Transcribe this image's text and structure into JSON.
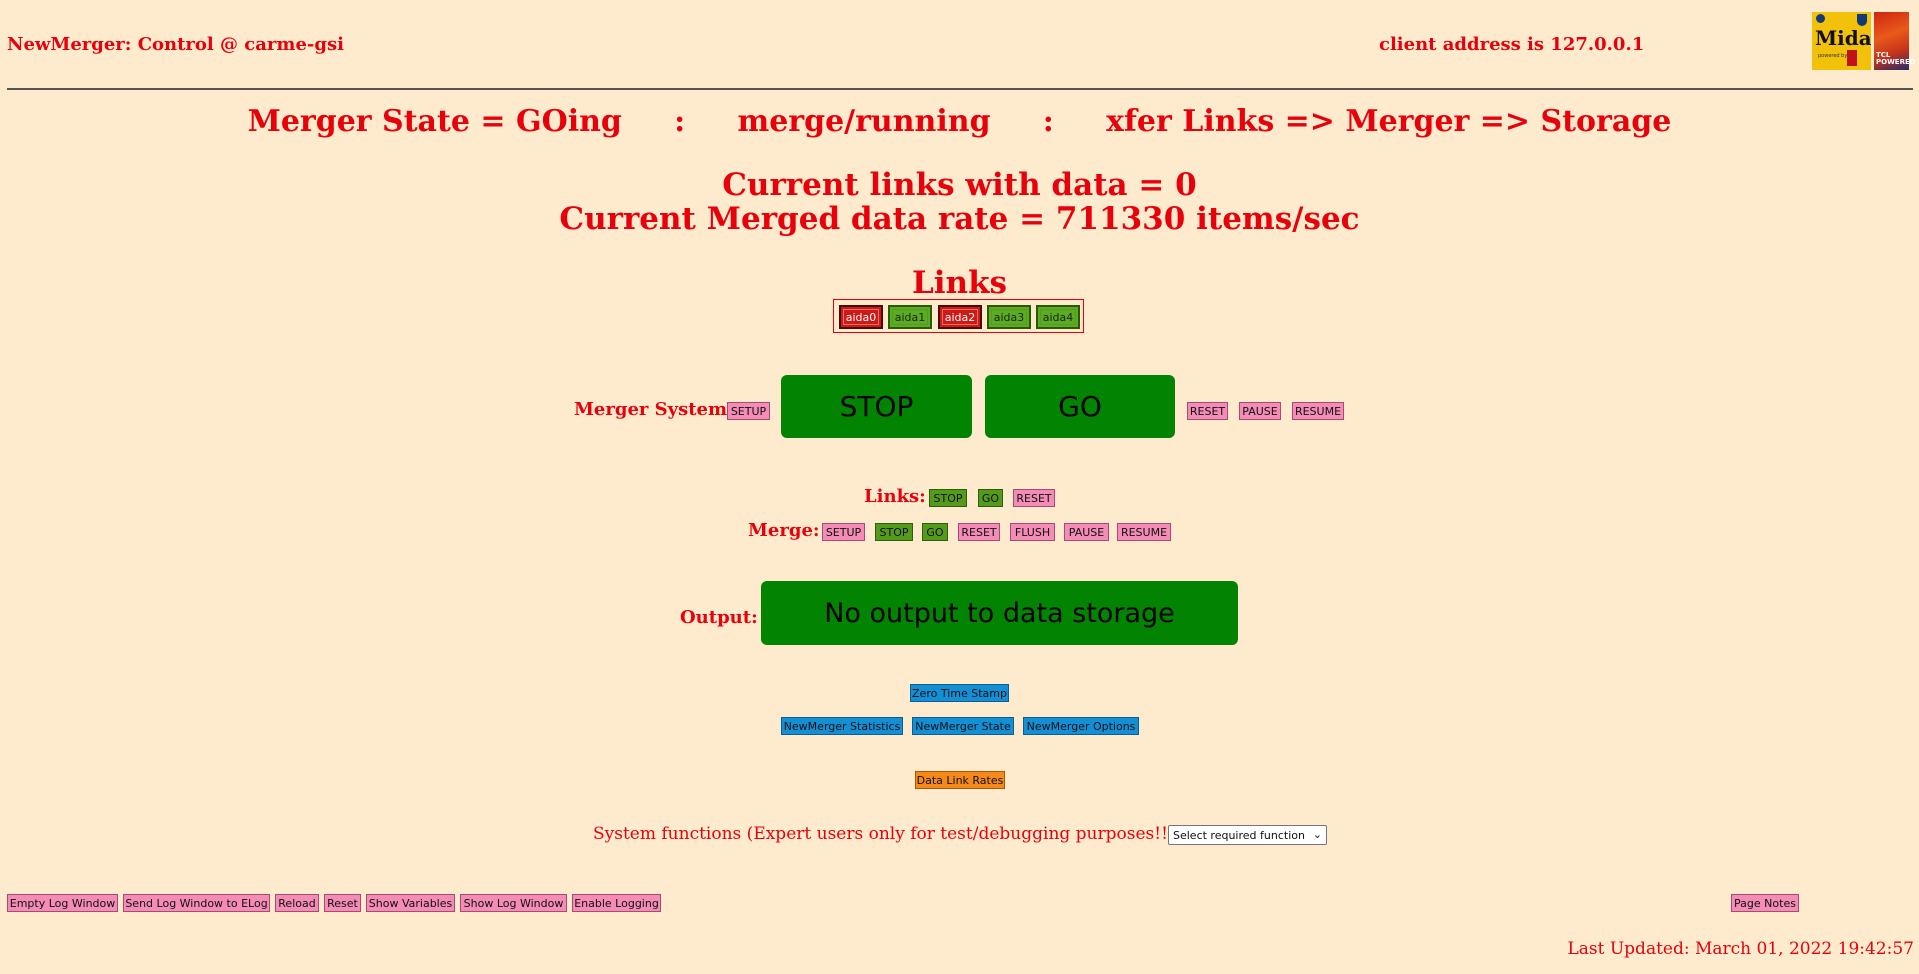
{
  "header": {
    "title": "NewMerger: Control @ carme-gsi",
    "client": "client address is 127.0.0.1",
    "logos": {
      "midas": "Midas",
      "midas_sub": "powered by",
      "tcl": "TCL POWERED"
    }
  },
  "status": {
    "merger_state": "Merger State = GOing",
    "sep": ":",
    "mode": "merge/running",
    "xfer": "xfer Links => Merger => Storage",
    "links_with_data": "Current links with data = 0",
    "data_rate": "Current Merged data rate = 711330 items/sec"
  },
  "links": {
    "title": "Links",
    "items": [
      {
        "label": "aida0",
        "state": "red"
      },
      {
        "label": "aida1",
        "state": "green"
      },
      {
        "label": "aida2",
        "state": "red"
      },
      {
        "label": "aida3",
        "state": "green"
      },
      {
        "label": "aida4",
        "state": "green"
      }
    ]
  },
  "merger_system": {
    "label": "Merger System:",
    "setup": "SETUP",
    "stop": "STOP",
    "go": "GO",
    "reset": "RESET",
    "pause": "PAUSE",
    "resume": "RESUME"
  },
  "links_controls": {
    "label": "Links:",
    "stop": "STOP",
    "go": "GO",
    "reset": "RESET"
  },
  "merge_controls": {
    "label": "Merge:",
    "setup": "SETUP",
    "stop": "STOP",
    "go": "GO",
    "reset": "RESET",
    "flush": "FLUSH",
    "pause": "PAUSE",
    "resume": "RESUME"
  },
  "output": {
    "label": "Output:",
    "value": "No output to data storage"
  },
  "tools": {
    "zero_ts": "Zero Time Stamp",
    "statistics": "NewMerger Statistics",
    "state": "NewMerger State",
    "options": "NewMerger Options",
    "link_rates": "Data Link Rates"
  },
  "system_functions": {
    "label": "System functions (Expert users only for test/debugging purposes!!!)",
    "select_value": "Select required function"
  },
  "footer": {
    "buttons": [
      "Empty Log Window",
      "Send Log Window to ELog",
      "Reload",
      "Reset",
      "Show Variables",
      "Show Log Window",
      "Enable Logging"
    ],
    "page_notes": "Page Notes",
    "last_updated": "Last Updated: March 01, 2022 19:42:57"
  },
  "colors": {
    "background": "#feebcd",
    "text": "#e8000b",
    "big_green": "#028302",
    "pink": "#f48cb6",
    "green_small": "#559b1b",
    "blue": "#138fd6",
    "orange": "#f58a1a"
  }
}
